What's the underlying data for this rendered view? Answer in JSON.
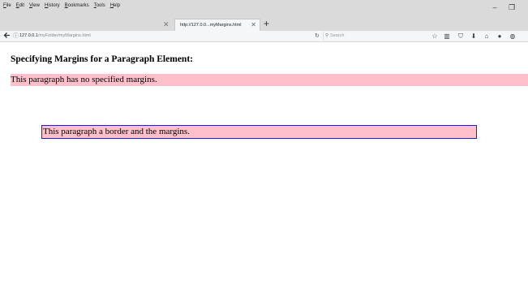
{
  "menu": [
    "File",
    "Edit",
    "View",
    "History",
    "Bookmarks",
    "Tools",
    "Help"
  ],
  "window_controls": {
    "minimize": "–",
    "restore": "❐"
  },
  "tab": {
    "title": "http://127.0.0...myMargins.html",
    "close": "✕"
  },
  "new_tab": "+",
  "nav": {
    "url_host": "127.0.0.1",
    "url_path": "/myFolder/myMargins.html",
    "search_placeholder": "Search"
  },
  "toolbar_icons": [
    "star-icon",
    "library-icon",
    "pocket-icon",
    "download-icon",
    "home-icon",
    "account-icon",
    "extension-icon"
  ],
  "page": {
    "heading": "Specifying Margins for a Paragraph Element:",
    "para1": "This paragraph has no specified margins.",
    "para2": "This paragraph a border and the margins."
  },
  "colors": {
    "para_bg": "#ffc0cb",
    "border": "#1a1aff"
  }
}
